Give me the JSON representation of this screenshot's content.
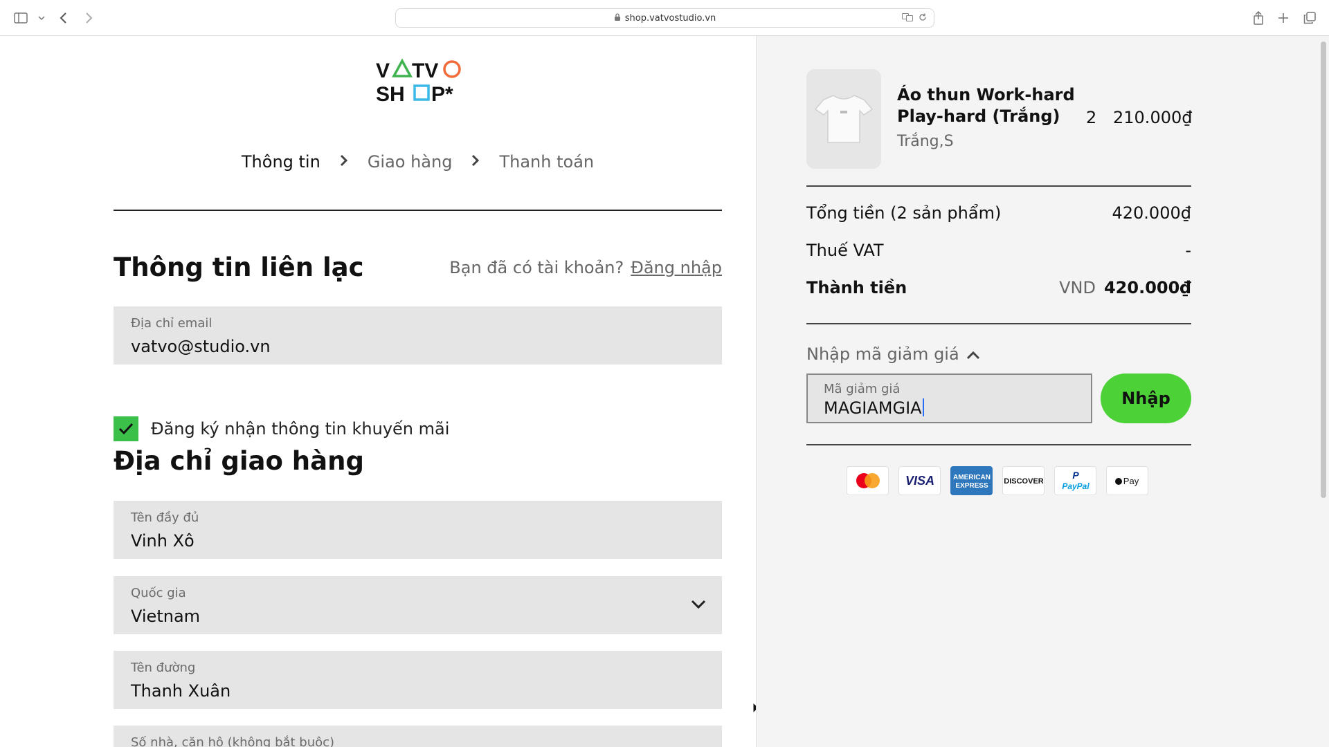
{
  "browser": {
    "url": "shop.vatvostudio.vn"
  },
  "logo": {
    "line1": "VATVO",
    "line2": "SHOP*"
  },
  "steps": [
    {
      "label": "Thông tin"
    },
    {
      "label": "Giao hàng"
    },
    {
      "label": "Thanh toán"
    }
  ],
  "contact": {
    "title": "Thông tin liên lạc",
    "have_account": "Bạn đã có tài khoản?",
    "login_link": "Đăng nhập",
    "email_label": "Địa chỉ email",
    "email_value": "vatvo@studio.vn",
    "newsletter_label": "Đăng ký nhận thông tin khuyến mãi",
    "newsletter_checked": true
  },
  "shipping": {
    "title": "Địa chỉ giao hàng",
    "name_label": "Tên đầy đủ",
    "name_value": "Vinh Xô",
    "country_label": "Quốc gia",
    "country_value": "Vietnam",
    "street_label": "Tên đường",
    "street_value": "Thanh Xuân",
    "next_label": "Số nhà, căn hộ (không bắt buộc)"
  },
  "cart": {
    "product_name": "Áo thun Work-hard Play-hard (Trắng)",
    "product_variant": "Trắng,S",
    "product_qty": "2",
    "product_price": "210.000₫",
    "subtotal_label": "Tổng tiền (2 sản phẩm)",
    "subtotal_value": "420.000₫",
    "vat_label": "Thuế VAT",
    "vat_value": "-",
    "total_label": "Thành tiền",
    "currency": "VND",
    "total_value": "420.000₫"
  },
  "promo": {
    "toggle_label": "Nhập mã giảm giá",
    "input_label": "Mã giảm giá",
    "input_value": "MAGIAMGIA",
    "apply_label": "Nhập"
  },
  "payments": [
    "Mastercard",
    "VISA",
    "American Express",
    "DISCOVER",
    "PayPal",
    "Apple Pay"
  ],
  "colors": {
    "accent_green": "#4cd137",
    "checkbox_green": "#3bc04a",
    "logo_green": "#3fb34f",
    "logo_orange": "#f26b3a",
    "logo_blue": "#3bb8e8"
  }
}
